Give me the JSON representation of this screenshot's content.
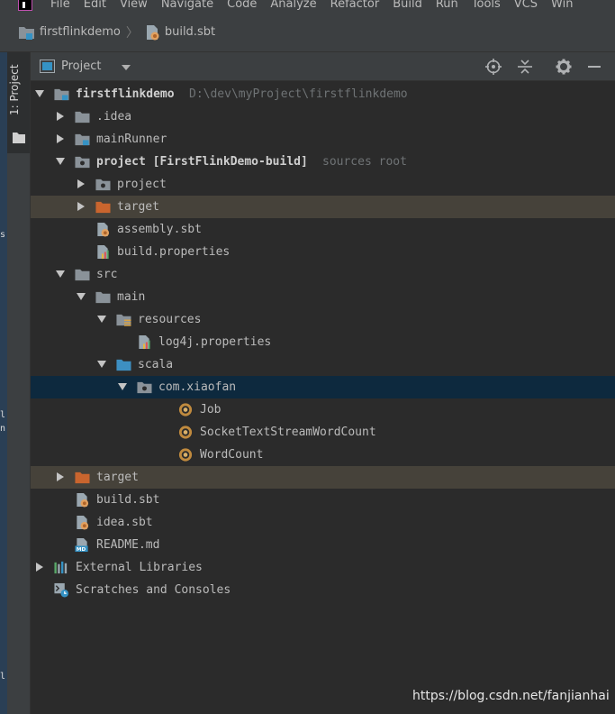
{
  "menubar": {
    "items": [
      "File",
      "Edit",
      "View",
      "Navigate",
      "Code",
      "Analyze",
      "Refactor",
      "Build",
      "Run",
      "Tools",
      "VCS",
      "Win"
    ]
  },
  "breadcrumb": {
    "items": [
      {
        "label": "firstflinkdemo",
        "icon": "module-folder-icon"
      },
      {
        "label": "build.sbt",
        "icon": "sbt-file-icon"
      }
    ]
  },
  "tool_strip": {
    "label": "1: Project"
  },
  "project_panel": {
    "title": "Project",
    "view_dropdown_icon": "chevron-down-icon",
    "actions": [
      "locate-icon",
      "collapse-all-icon",
      "gear-icon",
      "minimize-icon"
    ]
  },
  "tree": [
    {
      "label": "firstflinkdemo",
      "hint": "D:\\dev\\myProject\\firstflinkdemo",
      "icon": "module-folder-icon",
      "expanded": true,
      "depth": 0
    },
    {
      "label": ".idea",
      "icon": "folder-icon",
      "expanded": false,
      "depth": 1
    },
    {
      "label": "mainRunner",
      "icon": "module-folder-icon",
      "expanded": false,
      "depth": 1
    },
    {
      "label": "project [FirstFlinkDemo-build]",
      "hint": "sources root",
      "icon": "source-root-folder-icon",
      "expanded": true,
      "depth": 1
    },
    {
      "label": "project",
      "icon": "source-root-folder-icon",
      "expanded": false,
      "depth": 2
    },
    {
      "label": "target",
      "icon": "excluded-folder-icon",
      "expanded": false,
      "depth": 2,
      "excluded": true
    },
    {
      "label": "assembly.sbt",
      "icon": "sbt-file-icon",
      "depth": 2
    },
    {
      "label": "build.properties",
      "icon": "properties-file-icon",
      "depth": 2
    },
    {
      "label": "src",
      "icon": "folder-icon",
      "expanded": true,
      "depth": 1
    },
    {
      "label": "main",
      "icon": "folder-icon",
      "expanded": true,
      "depth": 2
    },
    {
      "label": "resources",
      "icon": "resources-folder-icon",
      "expanded": true,
      "depth": 3
    },
    {
      "label": "log4j.properties",
      "icon": "properties-file-icon",
      "depth": 4
    },
    {
      "label": "scala",
      "icon": "source-folder-icon",
      "expanded": true,
      "depth": 3
    },
    {
      "label": "com.xiaofan",
      "icon": "package-icon",
      "expanded": true,
      "depth": 4,
      "selected": true
    },
    {
      "label": "Job",
      "icon": "scala-object-icon",
      "depth": 6
    },
    {
      "label": "SocketTextStreamWordCount",
      "icon": "scala-object-icon",
      "depth": 6
    },
    {
      "label": "WordCount",
      "icon": "scala-object-icon",
      "depth": 6
    },
    {
      "label": "target",
      "icon": "excluded-folder-icon",
      "expanded": false,
      "depth": 1,
      "excluded": true
    },
    {
      "label": "build.sbt",
      "icon": "sbt-file-icon",
      "depth": 1
    },
    {
      "label": "idea.sbt",
      "icon": "sbt-file-icon",
      "depth": 1
    },
    {
      "label": "README.md",
      "icon": "markdown-file-icon",
      "depth": 1
    },
    {
      "label": "External Libraries",
      "icon": "libraries-icon",
      "expanded": false,
      "depth": 0
    },
    {
      "label": "Scratches and Consoles",
      "icon": "scratches-icon",
      "depth": 0
    }
  ],
  "watermark": "https://blog.csdn.net/fanjianhai",
  "colors": {
    "background": "#2b2b2b",
    "panel": "#3c3f41",
    "selection": "#0d293e",
    "excluded_row": "#46423a",
    "folder": "#8a9299",
    "excluded_folder": "#c9652e",
    "module_badge": "#3592c4"
  }
}
